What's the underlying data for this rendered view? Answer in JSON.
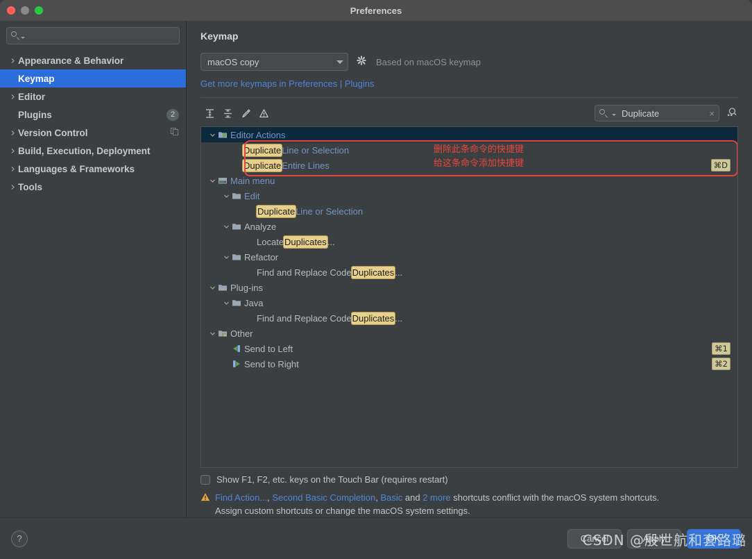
{
  "window": {
    "title": "Preferences"
  },
  "sidebar": {
    "search": {
      "value": "",
      "placeholder": ""
    },
    "items": [
      {
        "label": "Appearance & Behavior",
        "expandable": true,
        "selected": false,
        "badge": "",
        "icon": ""
      },
      {
        "label": "Keymap",
        "expandable": false,
        "selected": true,
        "badge": "",
        "icon": ""
      },
      {
        "label": "Editor",
        "expandable": true,
        "selected": false,
        "badge": "",
        "icon": ""
      },
      {
        "label": "Plugins",
        "expandable": false,
        "selected": false,
        "badge": "2",
        "icon": ""
      },
      {
        "label": "Version Control",
        "expandable": true,
        "selected": false,
        "badge": "",
        "icon": "copy-icon"
      },
      {
        "label": "Build, Execution, Deployment",
        "expandable": true,
        "selected": false,
        "badge": "",
        "icon": ""
      },
      {
        "label": "Languages & Frameworks",
        "expandable": true,
        "selected": false,
        "badge": "",
        "icon": ""
      },
      {
        "label": "Tools",
        "expandable": true,
        "selected": false,
        "badge": "",
        "icon": ""
      }
    ]
  },
  "main": {
    "page_title": "Keymap",
    "keymap_select": {
      "value": "macOS copy"
    },
    "based_on": "Based on macOS keymap",
    "plugins_link": "Get more keymaps in Preferences | Plugins",
    "toolbar": {
      "expand_all": "expand-all-icon",
      "collapse_all": "collapse-all-icon",
      "edit": "edit-pencil-icon",
      "conflicts": "warning-icon",
      "find_shortcut": "find-by-shortcut-icon"
    },
    "find": {
      "value": "Duplicate",
      "clear": "×"
    },
    "tree": [
      {
        "id": "editor-actions",
        "depth": 0,
        "twisty": "down",
        "icon": "editor-actions-icon",
        "selected": true,
        "parts": [
          {
            "t": "Editor Actions",
            "hl": false,
            "blue": true
          }
        ],
        "shortcut": ""
      },
      {
        "id": "duplicate-line-or-selection",
        "depth": 2,
        "twisty": "",
        "icon": "",
        "selected": false,
        "parts": [
          {
            "t": "Duplicate",
            "hl": true
          },
          {
            "t": " Line or Selection",
            "hl": false,
            "blue": true
          }
        ],
        "shortcut": ""
      },
      {
        "id": "duplicate-entire-lines",
        "depth": 2,
        "twisty": "",
        "icon": "",
        "selected": false,
        "parts": [
          {
            "t": "Duplicate",
            "hl": true
          },
          {
            "t": " Entire Lines",
            "hl": false,
            "blue": true
          }
        ],
        "shortcut": "⌘D"
      },
      {
        "id": "main-menu",
        "depth": 0,
        "twisty": "down",
        "icon": "main-menu-icon",
        "selected": false,
        "parts": [
          {
            "t": "Main menu",
            "hl": false,
            "blue": true
          }
        ],
        "shortcut": ""
      },
      {
        "id": "edit",
        "depth": 1,
        "twisty": "down",
        "icon": "folder-icon",
        "selected": false,
        "parts": [
          {
            "t": "Edit",
            "hl": false,
            "blue": true
          }
        ],
        "shortcut": ""
      },
      {
        "id": "edit-duplicate-line-or-selection",
        "depth": 3,
        "twisty": "",
        "icon": "",
        "selected": false,
        "parts": [
          {
            "t": "Duplicate",
            "hl": true
          },
          {
            "t": " Line or Selection",
            "hl": false,
            "blue": true
          }
        ],
        "shortcut": ""
      },
      {
        "id": "analyze",
        "depth": 1,
        "twisty": "down",
        "icon": "folder-icon",
        "selected": false,
        "parts": [
          {
            "t": "Analyze",
            "hl": false,
            "grey": true
          }
        ],
        "shortcut": ""
      },
      {
        "id": "locate-duplicates",
        "depth": 3,
        "twisty": "",
        "icon": "",
        "selected": false,
        "parts": [
          {
            "t": "Locate ",
            "hl": false,
            "grey": true
          },
          {
            "t": "Duplicates",
            "hl": true
          },
          {
            "t": "...",
            "hl": false,
            "grey": true
          }
        ],
        "shortcut": ""
      },
      {
        "id": "refactor",
        "depth": 1,
        "twisty": "down",
        "icon": "folder-icon",
        "selected": false,
        "parts": [
          {
            "t": "Refactor",
            "hl": false,
            "grey": true
          }
        ],
        "shortcut": ""
      },
      {
        "id": "find-and-replace-code-duplicates-refactor",
        "depth": 3,
        "twisty": "",
        "icon": "",
        "selected": false,
        "parts": [
          {
            "t": "Find and Replace Code ",
            "hl": false,
            "grey": true
          },
          {
            "t": "Duplicates",
            "hl": true
          },
          {
            "t": "...",
            "hl": false,
            "grey": true
          }
        ],
        "shortcut": ""
      },
      {
        "id": "plug-ins",
        "depth": 0,
        "twisty": "down",
        "icon": "folder-icon",
        "selected": false,
        "parts": [
          {
            "t": "Plug-ins",
            "hl": false,
            "grey": true
          }
        ],
        "shortcut": ""
      },
      {
        "id": "java",
        "depth": 1,
        "twisty": "down",
        "icon": "folder-icon",
        "selected": false,
        "parts": [
          {
            "t": "Java",
            "hl": false,
            "grey": true
          }
        ],
        "shortcut": ""
      },
      {
        "id": "find-and-replace-code-duplicates-java",
        "depth": 3,
        "twisty": "",
        "icon": "",
        "selected": false,
        "parts": [
          {
            "t": "Find and Replace Code ",
            "hl": false,
            "grey": true
          },
          {
            "t": "Duplicates",
            "hl": true
          },
          {
            "t": "...",
            "hl": false,
            "grey": true
          }
        ],
        "shortcut": ""
      },
      {
        "id": "other",
        "depth": 0,
        "twisty": "down",
        "icon": "other-icon",
        "selected": false,
        "parts": [
          {
            "t": "Other",
            "hl": false,
            "grey": true
          }
        ],
        "shortcut": ""
      },
      {
        "id": "send-to-left",
        "depth": 2,
        "twisty": "",
        "icon": "send-left-icon",
        "selected": false,
        "parts": [
          {
            "t": "Send to Left",
            "hl": false,
            "grey": true
          }
        ],
        "shortcut": "⌘1"
      },
      {
        "id": "send-to-right",
        "depth": 2,
        "twisty": "",
        "icon": "send-right-icon",
        "selected": false,
        "parts": [
          {
            "t": "Send to Right",
            "hl": false,
            "grey": true
          }
        ],
        "shortcut": "⌘2"
      }
    ],
    "annotations": [
      {
        "text": "删除此条命令的快捷键"
      },
      {
        "text": "给这条命令添加快捷键"
      }
    ],
    "touchbar_checkbox_label": "Show F1, F2, etc. keys on the Touch Bar (requires restart)",
    "conflict_warning": {
      "links": [
        "Find Action...",
        "Second Basic Completion",
        "Basic",
        "2 more"
      ],
      "line1_a": "Find Action...",
      "line1_sep1": ", ",
      "line1_b": "Second Basic Completion",
      "line1_sep2": ", ",
      "line1_c": "Basic",
      "line1_and": " and ",
      "line1_d": "2 more",
      "line1_tail": " shortcuts conflict with the macOS system shortcuts.",
      "line2": "Assign custom shortcuts or change the macOS system settings."
    }
  },
  "footer": {
    "help": "?",
    "cancel": "Cancel",
    "apply": "Apply",
    "ok": "OK"
  },
  "watermark": "CSDN @殷世航和套路璐",
  "colors": {
    "accent_blue": "#2d6ddb",
    "tree_selected": "#0d293e",
    "highlight_yellow": "#e6d08b",
    "annotation_red": "#e8453c",
    "link_blue": "#4e86d6"
  }
}
